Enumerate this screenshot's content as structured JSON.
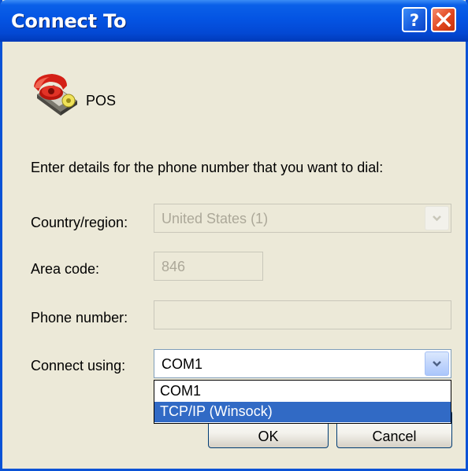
{
  "window": {
    "title": "Connect To"
  },
  "titlebar": {
    "help_glyph": "?",
    "help_icon": "question-mark-icon",
    "close_icon": "close-x-icon"
  },
  "connection": {
    "name": "POS",
    "icon": "red-telephone-icon"
  },
  "instructions": "Enter details for the phone number that you want to dial:",
  "form": {
    "country": {
      "label": "Country/region:",
      "value": "United States (1)",
      "disabled": true
    },
    "area_code": {
      "label": "Area code:",
      "value": "846",
      "disabled": true
    },
    "phone": {
      "label": "Phone number:",
      "value": "",
      "disabled": true
    },
    "connect_using": {
      "label": "Connect using:",
      "value": "COM1",
      "options": [
        "COM1",
        "TCP/IP (Winsock)"
      ],
      "highlighted": "TCP/IP (Winsock)"
    }
  },
  "buttons": {
    "ok": "OK",
    "cancel": "Cancel"
  },
  "colors": {
    "titlebar": "#0454e3",
    "dialog_bg": "#ece9d8",
    "selection": "#316ac5",
    "close": "#e1461e"
  }
}
